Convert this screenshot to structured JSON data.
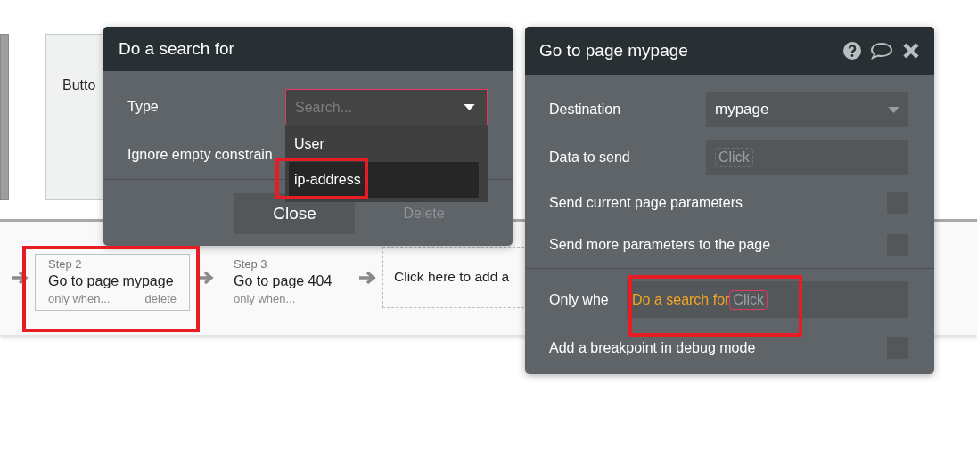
{
  "canvas": {
    "element_label": "Butto"
  },
  "workflow": {
    "steps": [
      {
        "step": "Step 2",
        "action": "Go to page mypage",
        "condition": "only when...",
        "delete": "delete",
        "selected": true
      },
      {
        "step": "Step 3",
        "action": "Go to page 404",
        "condition": "only when...",
        "selected": false
      }
    ],
    "add_action": "Click here to add a"
  },
  "search_popup": {
    "title": "Do a search for",
    "type_label": "Type",
    "type_dropdown": {
      "placeholder": "Search...",
      "expanded": true,
      "options": [
        {
          "label": "User",
          "selected": false
        },
        {
          "label": "ip-address",
          "selected": true
        }
      ]
    },
    "ignore_label": "Ignore empty constrain",
    "buttons": [
      {
        "label": "Close",
        "disabled": false
      },
      {
        "label": "Delete",
        "disabled": true
      }
    ]
  },
  "action_popup": {
    "title": "Go to page mypage",
    "rows": [
      {
        "kind": "dropdown",
        "label": "Destination",
        "value": "mypage"
      },
      {
        "kind": "expression",
        "label": "Data to send",
        "placeholder": "Click"
      },
      {
        "kind": "checkbox",
        "label": "Send current page parameters",
        "checked": false
      },
      {
        "kind": "checkbox",
        "label": "Send more parameters to the page",
        "checked": false
      },
      {
        "kind": "condition",
        "label": "Only whe",
        "expression": "Do a search for",
        "placeholder": "Click"
      },
      {
        "kind": "checkbox",
        "label": "Add a breakpoint in debug mode",
        "checked": false
      }
    ]
  }
}
